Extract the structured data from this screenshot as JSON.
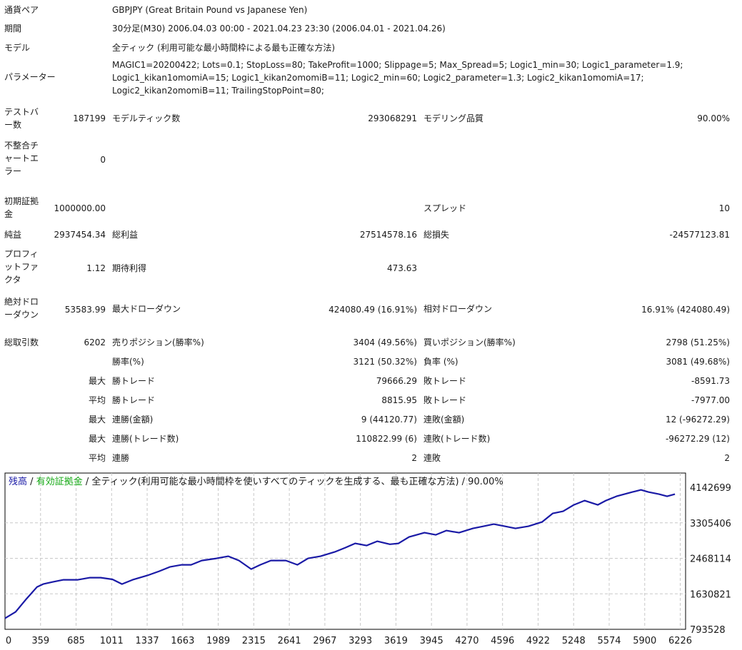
{
  "report": {
    "symbol_label": "通貨ペア",
    "symbol_value": "GBPJPY (Great Britain Pound vs Japanese Yen)",
    "period_label": "期間",
    "period_value": "30分足(M30) 2006.04.03 00:00 - 2021.04.23 23:30 (2006.04.01 - 2021.04.26)",
    "model_label": "モデル",
    "model_value": "全ティック (利用可能な最小時間枠による最も正確な方法)",
    "params_label": "パラメーター",
    "params_lines": [
      "MAGIC1=20200422; Lots=0.1; StopLoss=80; TakeProfit=1000; Slippage=5; Max_Spread=5; Logic1_min=30; Logic1_parameter=1.9;",
      "Logic1_kikan1omomiA=15; Logic1_kikan2omomiB=11; Logic2_min=60; Logic2_parameter=1.3; Logic2_kikan1omomiA=17;",
      "Logic2_kikan2omomiB=11; TrailingStopPoint=80;"
    ],
    "bars_label_1": "テストバ",
    "bars_label_2": "ー数",
    "bars_value": "187199",
    "ticks_label": "モデルティック数",
    "ticks_value": "293068291",
    "quality_label": "モデリング品質",
    "quality_value": "90.00%",
    "mismatch_label_1": "不整合チ",
    "mismatch_label_2": "ャートエ",
    "mismatch_label_3": "ラー",
    "mismatch_value": "0",
    "deposit_label_1": "初期証拠",
    "deposit_label_2": "金",
    "deposit_value": "1000000.00",
    "spread_label": "スプレッド",
    "spread_value": "10",
    "net_label": "純益",
    "net_value": "2937454.34",
    "gross_profit_label": "総利益",
    "gross_profit_value": "27514578.16",
    "gross_loss_label": "総損失",
    "gross_loss_value": "-24577123.81",
    "pf_label_1": "プロフィ",
    "pf_label_2": "ットファ",
    "pf_label_3": "クタ",
    "pf_value": "1.12",
    "expected_label": "期待利得",
    "expected_value": "473.63",
    "abs_dd_label_1": "絶対ドロ",
    "abs_dd_label_2": "ーダウン",
    "abs_dd_value": "53583.99",
    "max_dd_label": "最大ドローダウン",
    "max_dd_value": "424080.49 (16.91%)",
    "rel_dd_label": "相対ドローダウン",
    "rel_dd_value": "16.91% (424080.49)",
    "total_trades_label": "総取引数",
    "total_trades_value": "6202",
    "short_label": "売りポジション(勝率%)",
    "short_value": "3404 (49.56%)",
    "long_label": "買いポジション(勝率%)",
    "long_value": "2798 (51.25%)",
    "win_rate_label": "勝率(%)",
    "win_rate_value": "3121 (50.32%)",
    "loss_rate_label": "負率 (%)",
    "loss_rate_value": "3081 (49.68%)",
    "max_label": "最大",
    "avg_label": "平均",
    "largest_win_label": "勝トレード",
    "largest_win_value": "79666.29",
    "largest_loss_label": "敗トレード",
    "largest_loss_value": "-8591.73",
    "avg_win_label": "勝トレード",
    "avg_win_value": "8815.95",
    "avg_loss_label": "敗トレード",
    "avg_loss_value": "-7977.00",
    "max_consec_win_label": "連勝(金額)",
    "max_consec_win_value": "9 (44120.77)",
    "max_consec_loss_label": "連敗(金額)",
    "max_consec_loss_value": "12 (-96272.29)",
    "max_consec_profit_label": "連勝(トレード数)",
    "max_consec_profit_value": "110822.99 (6)",
    "max_consec_lossamt_label": "連敗(トレード数)",
    "max_consec_lossamt_value": "-96272.29 (12)",
    "avg_consec_win_label": "連勝",
    "avg_consec_win_value": "2",
    "avg_consec_loss_label": "連敗",
    "avg_consec_loss_value": "2"
  },
  "chart_legend": {
    "balance": "残高",
    "sep1": "/",
    "equity": "有効証拠金",
    "sep2": "/",
    "rest": "全ティック(利用可能な最小時間枠を使いすべてのティックを生成する、最も正確な方法) / 90.00%"
  },
  "colors": {
    "balance": "#1a1aa6",
    "equity": "#13a813",
    "grid": "#c8c8c8",
    "frame": "#000000"
  },
  "chart_data": {
    "type": "line",
    "xlabel": "",
    "ylabel": "",
    "x_ticks": [
      "0",
      "359",
      "685",
      "1011",
      "1337",
      "1663",
      "1989",
      "2315",
      "2641",
      "2967",
      "3293",
      "3619",
      "3945",
      "4270",
      "4596",
      "4922",
      "5248",
      "5574",
      "5900",
      "6226"
    ],
    "y_ticks": [
      "4142699",
      "3305406",
      "2468114",
      "1630821",
      "793528"
    ],
    "xlim": [
      0,
      6400
    ],
    "ylim": [
      793528,
      4142699
    ],
    "grid": true,
    "series": [
      {
        "name": "残高",
        "x": [
          0,
          100,
          200,
          300,
          359,
          450,
          550,
          685,
          800,
          900,
          1011,
          1100,
          1150,
          1200,
          1337,
          1450,
          1550,
          1663,
          1750,
          1850,
          1989,
          2100,
          2200,
          2315,
          2400,
          2500,
          2641,
          2750,
          2850,
          2967,
          3100,
          3200,
          3293,
          3400,
          3500,
          3619,
          3700,
          3800,
          3945,
          4050,
          4150,
          4270,
          4400,
          4500,
          4596,
          4700,
          4800,
          4922,
          5050,
          5150,
          5248,
          5350,
          5450,
          5574,
          5650,
          5750,
          5900,
          5980,
          6050,
          6150,
          6226,
          6300
        ],
        "y": [
          1050000,
          1200000,
          1500000,
          1780000,
          1850000,
          1900000,
          1950000,
          1950000,
          2000000,
          2000000,
          1960000,
          1850000,
          1900000,
          1950000,
          2050000,
          2150000,
          2250000,
          2300000,
          2300000,
          2400000,
          2450000,
          2500000,
          2400000,
          2200000,
          2300000,
          2400000,
          2400000,
          2300000,
          2450000,
          2500000,
          2600000,
          2700000,
          2800000,
          2750000,
          2850000,
          2780000,
          2800000,
          2950000,
          3050000,
          3000000,
          3100000,
          3050000,
          3150000,
          3200000,
          3250000,
          3200000,
          3150000,
          3200000,
          3300000,
          3500000,
          3550000,
          3700000,
          3800000,
          3700000,
          3800000,
          3900000,
          4000000,
          4050000,
          4000000,
          3950000,
          3900000,
          3950000
        ]
      }
    ]
  }
}
